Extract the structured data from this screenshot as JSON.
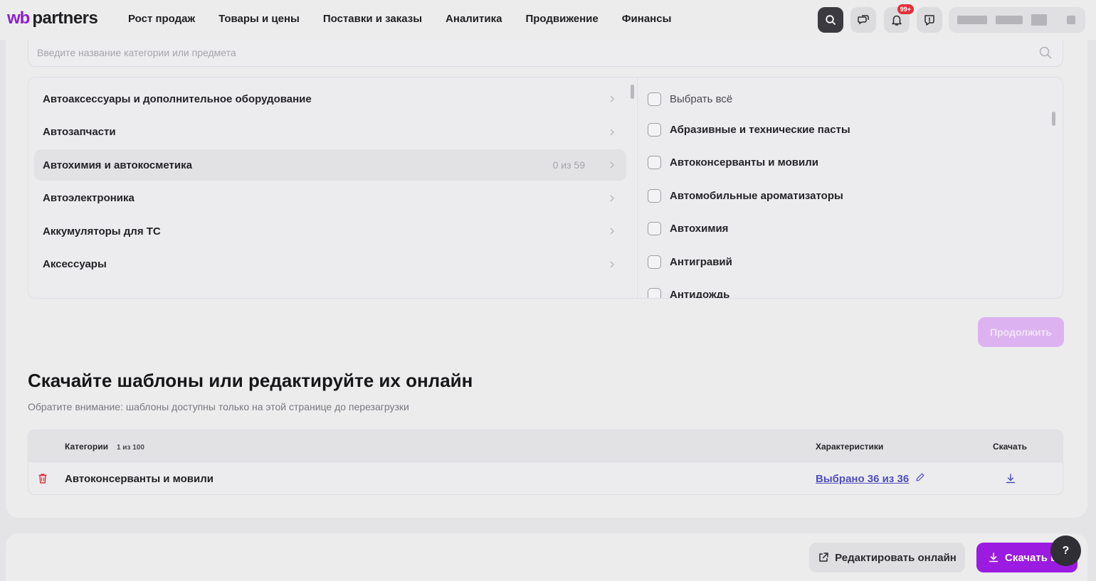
{
  "header": {
    "logo_wb": "wb",
    "logo_partners": "partners",
    "nav": [
      "Рост продаж",
      "Товары и цены",
      "Поставки и заказы",
      "Аналитика",
      "Продвижение",
      "Финансы"
    ],
    "notifications_badge": "99+"
  },
  "search": {
    "placeholder": "Введите название категории или предмета",
    "value": ""
  },
  "categories": [
    {
      "label": "Автоаксессуары и дополнительное оборудование",
      "count": ""
    },
    {
      "label": "Автозапчасти",
      "count": ""
    },
    {
      "label": "Автохимия и автокосметика",
      "count": "0 из 59"
    },
    {
      "label": "Автоэлектроника",
      "count": ""
    },
    {
      "label": "Аккумуляторы для ТС",
      "count": ""
    },
    {
      "label": "Аксессуары",
      "count": ""
    }
  ],
  "subjects": {
    "select_all": "Выбрать всё",
    "items": [
      "Абразивные и технические пасты",
      "Автоконсерванты и мовили",
      "Автомобильные ароматизаторы",
      "Автохимия",
      "Антигравий",
      "Антидождь"
    ]
  },
  "continue_label": "Продолжить",
  "templates": {
    "title": "Скачайте шаблоны или редактируйте их онлайн",
    "note": "Обратите внимание: шаблоны доступны только на этой странице до перезагрузки",
    "columns": {
      "categories": "Категории",
      "pagination": "1 из 100",
      "characteristics": "Характеристики",
      "download": "Скачать"
    },
    "rows": [
      {
        "name": "Автоконсерванты и мовили",
        "selected": "Выбрано 36 из 36"
      }
    ]
  },
  "bottom": {
    "edit_online": "Редактировать онлайн",
    "download": "Скачать в",
    "help": "?"
  },
  "colors": {
    "accent": "#9b1be0",
    "accent_disabled": "#dcb3f0",
    "link": "#4e4ec0",
    "danger": "#e0303a"
  }
}
